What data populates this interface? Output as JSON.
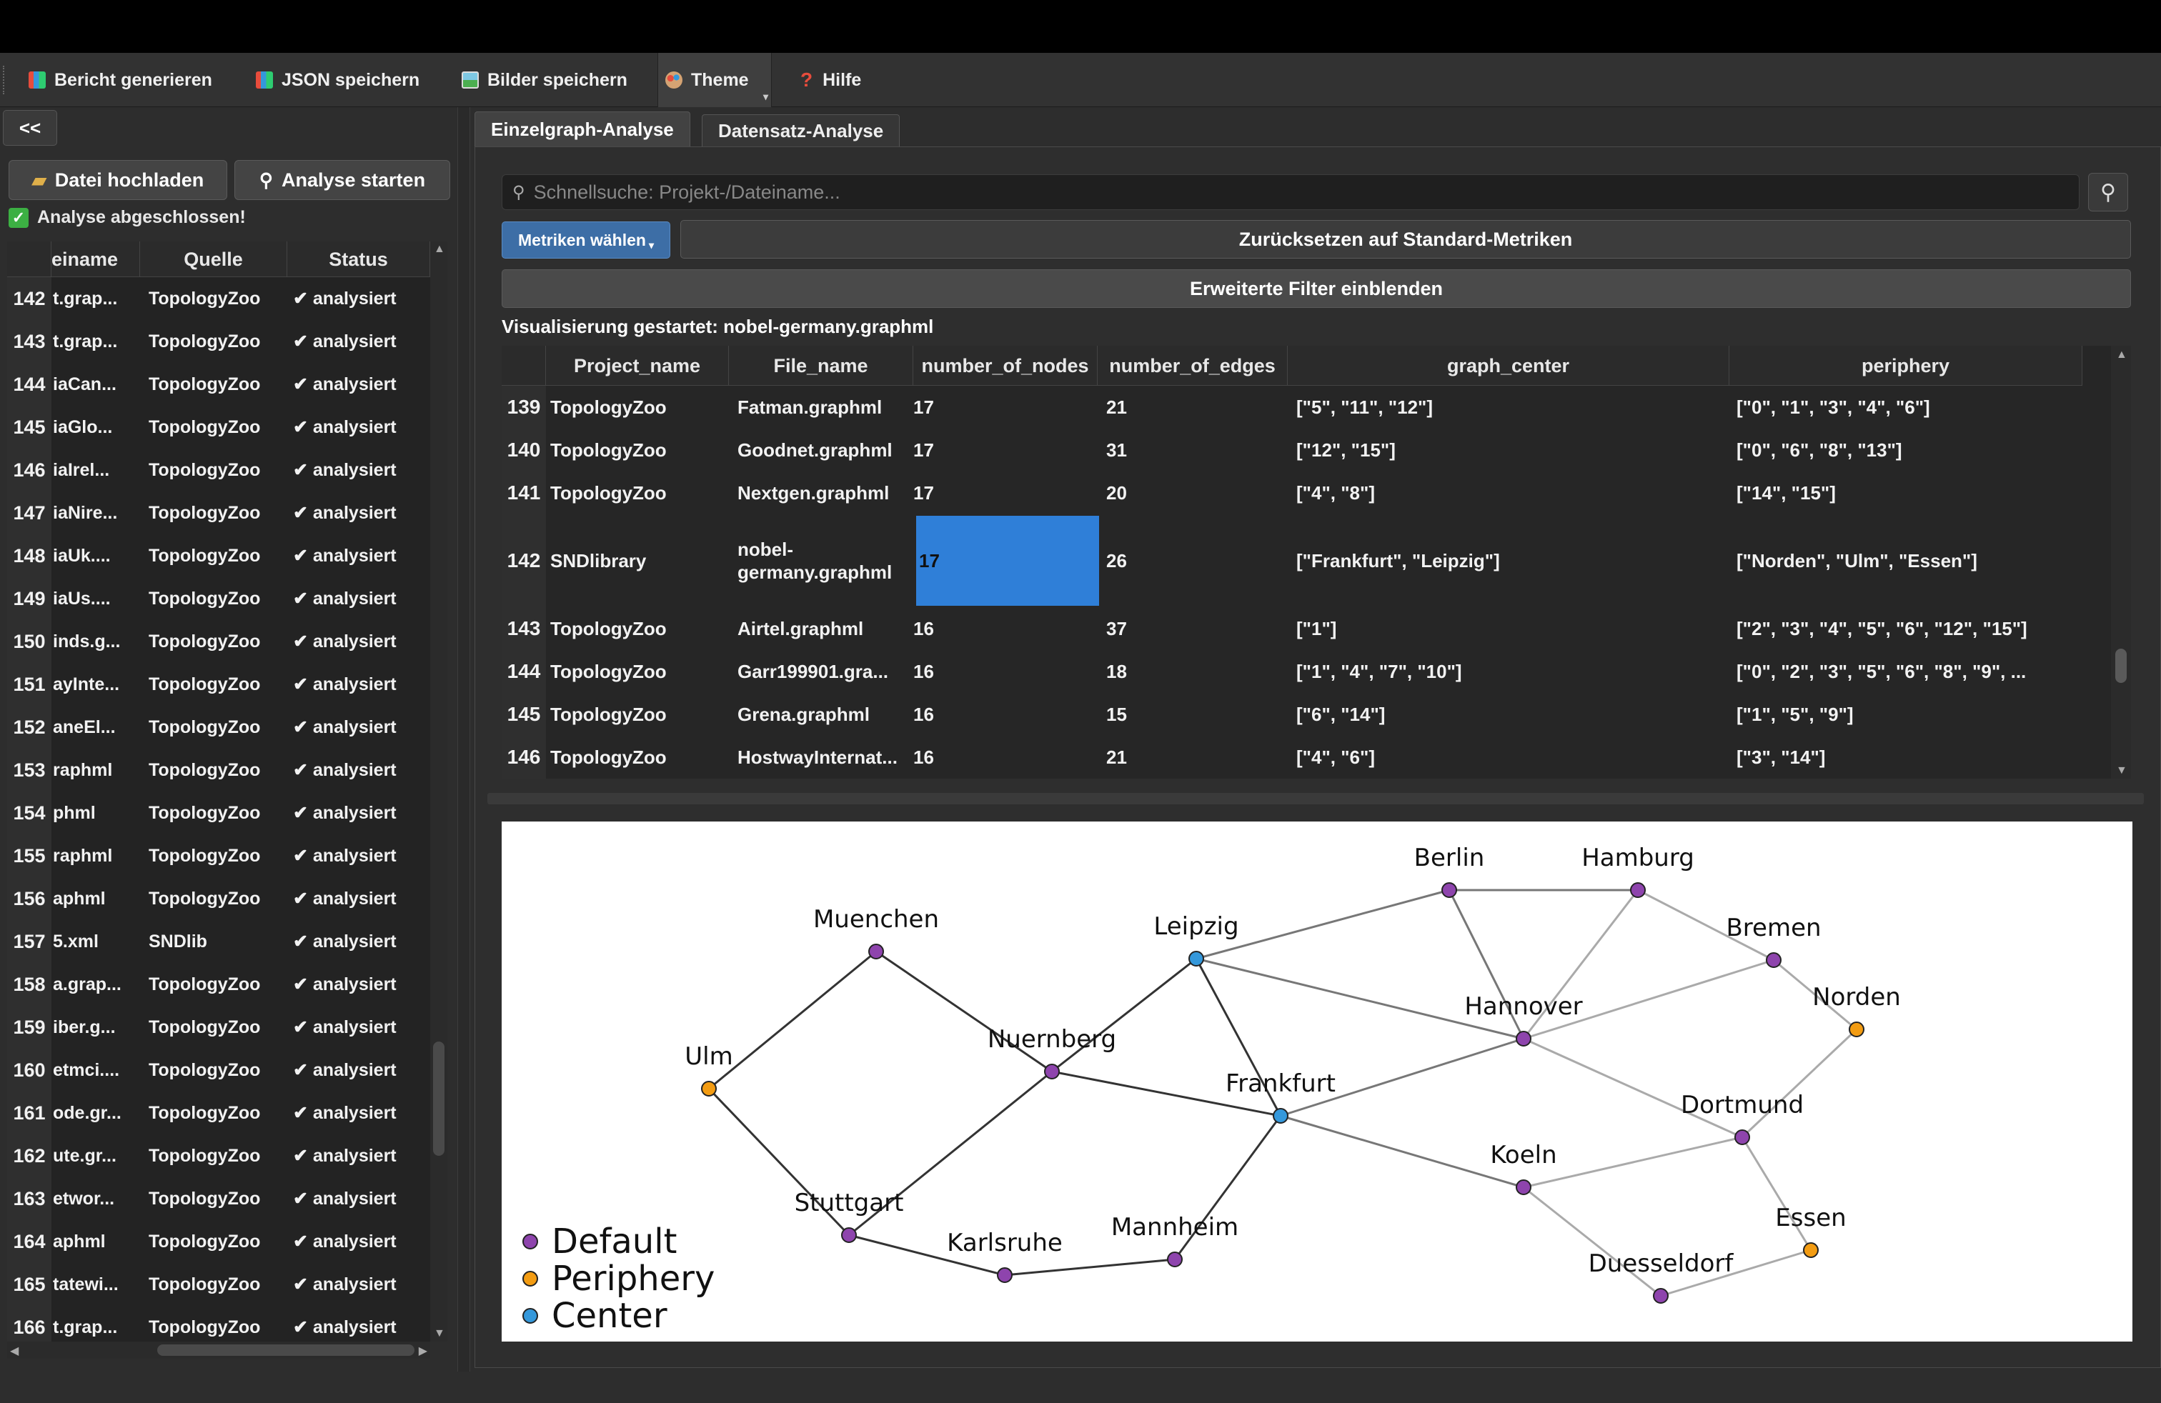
{
  "menu": {
    "items": [
      {
        "label": "Bericht generieren",
        "icon": "chart-icon"
      },
      {
        "label": "JSON speichern",
        "icon": "chart-icon"
      },
      {
        "label": "Bilder speichern",
        "icon": "image-icon"
      },
      {
        "label": "Theme",
        "icon": "palette-icon"
      },
      {
        "label": "Hilfe",
        "icon": "question-icon"
      }
    ]
  },
  "left": {
    "collapse_label": "<<",
    "upload_label": "Datei hochladen",
    "analyze_label": "Analyse starten",
    "status_text": "Analyse abgeschlossen!",
    "columns": [
      "einame",
      "Quelle",
      "Status"
    ],
    "rows": [
      {
        "n": "142",
        "name": "t.grap...",
        "source": "TopologyZoo",
        "status": "✔ analysiert"
      },
      {
        "n": "143",
        "name": "t.grap...",
        "source": "TopologyZoo",
        "status": "✔ analysiert"
      },
      {
        "n": "144",
        "name": "iaCan...",
        "source": "TopologyZoo",
        "status": "✔ analysiert"
      },
      {
        "n": "145",
        "name": "iaGlo...",
        "source": "TopologyZoo",
        "status": "✔ analysiert"
      },
      {
        "n": "146",
        "name": "iaIrel...",
        "source": "TopologyZoo",
        "status": "✔ analysiert"
      },
      {
        "n": "147",
        "name": "iaNire...",
        "source": "TopologyZoo",
        "status": "✔ analysiert"
      },
      {
        "n": "148",
        "name": "iaUk....",
        "source": "TopologyZoo",
        "status": "✔ analysiert"
      },
      {
        "n": "149",
        "name": "iaUs....",
        "source": "TopologyZoo",
        "status": "✔ analysiert"
      },
      {
        "n": "150",
        "name": "inds.g...",
        "source": "TopologyZoo",
        "status": "✔ analysiert"
      },
      {
        "n": "151",
        "name": "ayInte...",
        "source": "TopologyZoo",
        "status": "✔ analysiert"
      },
      {
        "n": "152",
        "name": "aneEl...",
        "source": "TopologyZoo",
        "status": "✔ analysiert"
      },
      {
        "n": "153",
        "name": "raphml",
        "source": "TopologyZoo",
        "status": "✔ analysiert"
      },
      {
        "n": "154",
        "name": "phml",
        "source": "TopologyZoo",
        "status": "✔ analysiert"
      },
      {
        "n": "155",
        "name": "raphml",
        "source": "TopologyZoo",
        "status": "✔ analysiert"
      },
      {
        "n": "156",
        "name": "aphml",
        "source": "TopologyZoo",
        "status": "✔ analysiert"
      },
      {
        "n": "157",
        "name": "5.xml",
        "source": "SNDlib",
        "status": "✔ analysiert"
      },
      {
        "n": "158",
        "name": "a.grap...",
        "source": "TopologyZoo",
        "status": "✔ analysiert"
      },
      {
        "n": "159",
        "name": "iber.g...",
        "source": "TopologyZoo",
        "status": "✔ analysiert"
      },
      {
        "n": "160",
        "name": "etmci....",
        "source": "TopologyZoo",
        "status": "✔ analysiert"
      },
      {
        "n": "161",
        "name": "ode.gr...",
        "source": "TopologyZoo",
        "status": "✔ analysiert"
      },
      {
        "n": "162",
        "name": "ute.gr...",
        "source": "TopologyZoo",
        "status": "✔ analysiert"
      },
      {
        "n": "163",
        "name": "etwor...",
        "source": "TopologyZoo",
        "status": "✔ analysiert"
      },
      {
        "n": "164",
        "name": "aphml",
        "source": "TopologyZoo",
        "status": "✔ analysiert"
      },
      {
        "n": "165",
        "name": "tatewi...",
        "source": "TopologyZoo",
        "status": "✔ analysiert"
      },
      {
        "n": "166",
        "name": "t.grap...",
        "source": "TopologyZoo",
        "status": "✔ analysiert"
      }
    ]
  },
  "tabs": [
    "Einzelgraph-Analyse",
    "Datensatz-Analyse"
  ],
  "search": {
    "placeholder": "Schnellsuche: Projekt-/Dateiname..."
  },
  "buttons": {
    "metrics": "Metriken wählen",
    "reset": "Zurücksetzen auf Standard-Metriken",
    "filter": "Erweiterte Filter einblenden"
  },
  "vis_label": "Visualisierung gestartet: nobel-germany.graphml",
  "table": {
    "columns": [
      "Project_name",
      "File_name",
      "number_of_nodes",
      "number_of_edges",
      "graph_center",
      "periphery"
    ],
    "rows": [
      {
        "n": "139",
        "project": "TopologyZoo",
        "file": "Fatman.graphml",
        "nodes": "17",
        "edges": "21",
        "center": "[\"5\", \"11\", \"12\"]",
        "periphery": "[\"0\", \"1\", \"3\", \"4\", \"6\"]"
      },
      {
        "n": "140",
        "project": "TopologyZoo",
        "file": "Goodnet.graphml",
        "nodes": "17",
        "edges": "31",
        "center": "[\"12\", \"15\"]",
        "periphery": "[\"0\", \"6\", \"8\", \"13\"]"
      },
      {
        "n": "141",
        "project": "TopologyZoo",
        "file": "Nextgen.graphml",
        "nodes": "17",
        "edges": "20",
        "center": "[\"4\", \"8\"]",
        "periphery": "[\"14\", \"15\"]"
      },
      {
        "n": "142",
        "project": "SNDlibrary",
        "file": "nobel-germany.graphml",
        "nodes": "17",
        "edges": "26",
        "center": "[\"Frankfurt\", \"Leipzig\"]",
        "periphery": "[\"Norden\", \"Ulm\", \"Essen\"]"
      },
      {
        "n": "143",
        "project": "TopologyZoo",
        "file": "Airtel.graphml",
        "nodes": "16",
        "edges": "37",
        "center": "[\"1\"]",
        "periphery": "[\"2\", \"3\", \"4\", \"5\", \"6\", \"12\", \"15\"]"
      },
      {
        "n": "144",
        "project": "TopologyZoo",
        "file": "Garr199901.gra...",
        "nodes": "16",
        "edges": "18",
        "center": "[\"1\", \"4\", \"7\", \"10\"]",
        "periphery": "[\"0\", \"2\", \"3\", \"5\", \"6\", \"8\", \"9\", ..."
      },
      {
        "n": "145",
        "project": "TopologyZoo",
        "file": "Grena.graphml",
        "nodes": "16",
        "edges": "15",
        "center": "[\"6\", \"14\"]",
        "periphery": "[\"1\", \"5\", \"9\"]"
      },
      {
        "n": "146",
        "project": "TopologyZoo",
        "file": "HostwayInternat...",
        "nodes": "16",
        "edges": "21",
        "center": "[\"4\", \"6\"]",
        "periphery": "[\"3\", \"14\"]"
      }
    ]
  },
  "graph": {
    "colors": {
      "default": "#8e44ad",
      "periphery": "#f39c12",
      "center": "#3498db"
    },
    "legend": [
      "Default",
      "Periphery",
      "Center"
    ],
    "nodes": {
      "Berlin": "default",
      "Hamburg": "default",
      "Muenchen": "default",
      "Leipzig": "center",
      "Bremen": "default",
      "Norden": "periphery",
      "Hannover": "default",
      "Ulm": "periphery",
      "Nuernberg": "default",
      "Frankfurt": "center",
      "Dortmund": "default",
      "Koeln": "default",
      "Stuttgart": "default",
      "Karlsruhe": "default",
      "Mannheim": "default",
      "Essen": "periphery",
      "Duesseldorf": "default"
    },
    "edges": [
      [
        "Berlin",
        "Hamburg"
      ],
      [
        "Berlin",
        "Hannover"
      ],
      [
        "Berlin",
        "Leipzig"
      ],
      [
        "Hamburg",
        "Hannover"
      ],
      [
        "Hamburg",
        "Bremen"
      ],
      [
        "Bremen",
        "Norden"
      ],
      [
        "Bremen",
        "Hannover"
      ],
      [
        "Norden",
        "Dortmund"
      ],
      [
        "Leipzig",
        "Hannover"
      ],
      [
        "Leipzig",
        "Frankfurt"
      ],
      [
        "Leipzig",
        "Nuernberg"
      ],
      [
        "Muenchen",
        "Nuernberg"
      ],
      [
        "Muenchen",
        "Ulm"
      ],
      [
        "Ulm",
        "Stuttgart"
      ],
      [
        "Stuttgart",
        "Nuernberg"
      ],
      [
        "Stuttgart",
        "Karlsruhe"
      ],
      [
        "Karlsruhe",
        "Mannheim"
      ],
      [
        "Mannheim",
        "Frankfurt"
      ],
      [
        "Nuernberg",
        "Frankfurt"
      ],
      [
        "Frankfurt",
        "Hannover"
      ],
      [
        "Frankfurt",
        "Koeln"
      ],
      [
        "Hannover",
        "Dortmund"
      ],
      [
        "Koeln",
        "Dortmund"
      ],
      [
        "Koeln",
        "Duesseldorf"
      ],
      [
        "Dortmund",
        "Essen"
      ],
      [
        "Essen",
        "Duesseldorf"
      ]
    ]
  }
}
